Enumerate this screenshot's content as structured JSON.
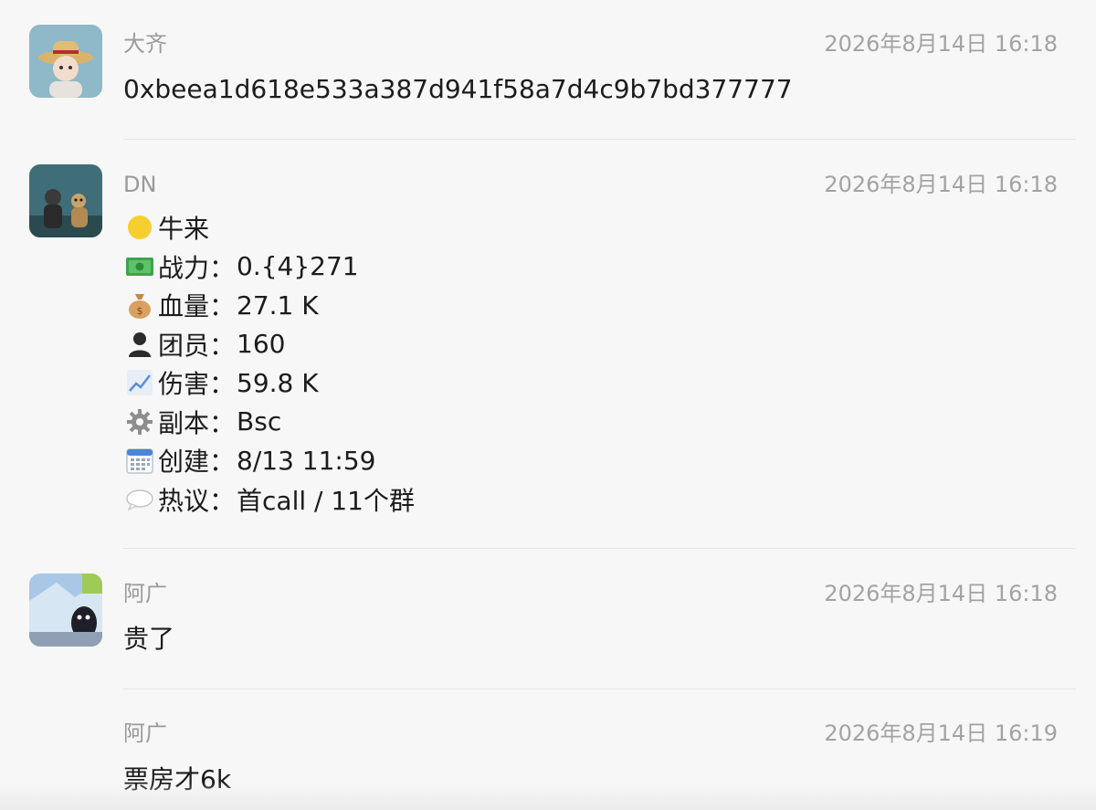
{
  "messages": [
    {
      "sender": "大齐",
      "time": "2026年8月14日 16:18",
      "text": "0xbeea1d618e533a387d941f58a7d4c9b7bd377777"
    },
    {
      "sender": "DN",
      "time": "2026年8月14日 16:18",
      "info": [
        {
          "icon": "yellow-circle-icon",
          "label": "牛来",
          "value": ""
        },
        {
          "icon": "money-bill-icon",
          "label": "战力：",
          "value": "0.{4}271"
        },
        {
          "icon": "money-bag-icon",
          "label": "血量：",
          "value": "27.1 K"
        },
        {
          "icon": "person-icon",
          "label": "团员：",
          "value": "160"
        },
        {
          "icon": "chart-up-icon",
          "label": "伤害：",
          "value": "59.8 K"
        },
        {
          "icon": "gear-icon",
          "label": "副本：",
          "value": "Bsc"
        },
        {
          "icon": "calendar-icon",
          "label": "创建：",
          "value": "8/13 11:59"
        },
        {
          "icon": "speech-bubble-icon",
          "label": "热议：",
          "value": "首call / 11个群"
        }
      ]
    },
    {
      "sender": "阿广",
      "time": "2026年8月14日 16:18",
      "text": "贵了"
    },
    {
      "sender": "阿广",
      "time": "2026年8月14日 16:19",
      "text": "票房才6k"
    }
  ],
  "colors": {
    "background": "#f7f7f7",
    "sender": "#9a9a9a",
    "time": "#a3a3a3",
    "text": "#1c1c1c"
  }
}
